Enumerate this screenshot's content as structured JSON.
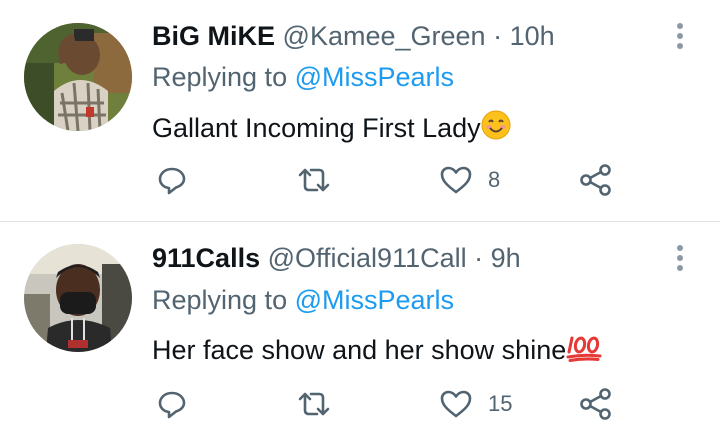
{
  "tweets": [
    {
      "name": "BiG MiKE",
      "handle": "@Kamee_Green",
      "time": "10h",
      "replying_prefix": "Replying to",
      "replying_to": "@MissPearls",
      "text": "Gallant Incoming First Lady",
      "emoji": "smiling-face-emoji",
      "likes": "8"
    },
    {
      "name": "911Calls",
      "handle": "@Official911Call",
      "time": "9h",
      "replying_prefix": "Replying to",
      "replying_to": "@MissPearls",
      "text": "Her face show and her show shine",
      "emoji": "hundred-points-emoji",
      "likes": "15"
    }
  ],
  "colors": {
    "text": "#0f1419",
    "secondary": "#536471",
    "link": "#1d9bf0",
    "divider": "#dfe3e6"
  }
}
